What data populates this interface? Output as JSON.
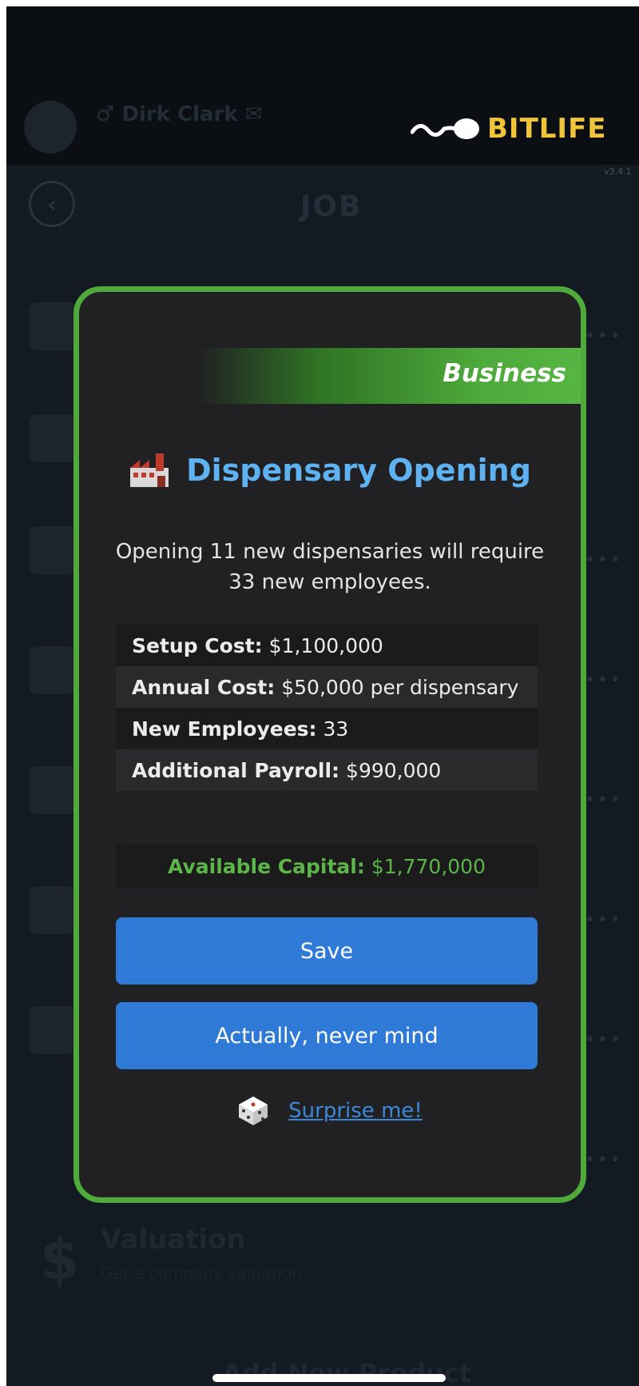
{
  "header": {
    "brand": "BITLIFE",
    "version": "v3.4.1",
    "character_name": "♂ Dirk Clark ✉",
    "character_sub": "",
    "screen_title": "JOB"
  },
  "background": {
    "valuation_title": "Valuation",
    "valuation_sub": "Get a company valuation",
    "bottom_item": "Add New Product"
  },
  "modal": {
    "ribbon_label": "Business",
    "title": "Dispensary Opening",
    "icon": "factory-icon",
    "description": "Opening 11 new dispensaries will require 33 new employees.",
    "stats": [
      {
        "label": "Setup Cost:",
        "value": "$1,100,000"
      },
      {
        "label": "Annual Cost:",
        "value": "$50,000 per dispensary"
      },
      {
        "label": "New Employees:",
        "value": "33"
      },
      {
        "label": "Additional Payroll:",
        "value": "$990,000"
      }
    ],
    "capital_label": "Available Capital:",
    "capital_value": "$1,770,000",
    "save_label": "Save",
    "cancel_label": "Actually, never mind",
    "surprise_label": "Surprise me!",
    "colors": {
      "border": "#4fa93b",
      "title": "#5eb2f1",
      "button": "#2f7ad6",
      "capital": "#5cb548"
    }
  }
}
